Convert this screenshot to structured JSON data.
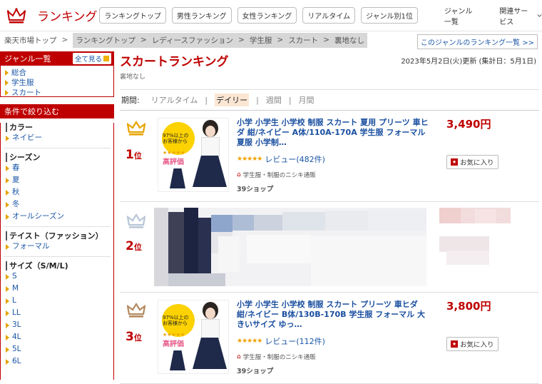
{
  "header": {
    "brand": "ランキング",
    "nav": [
      "ランキングトップ",
      "男性ランキング",
      "女性ランキング",
      "リアルタイム",
      "ジャンル別1位"
    ],
    "genre_list": "ジャンル一覧",
    "related": "関連サービス"
  },
  "breadcrumb": {
    "items": [
      "楽天市場トップ",
      "ランキングトップ",
      "レディースファッション",
      "学生服",
      "スカート",
      "裏地なし"
    ],
    "other_rank_link": "このジャンルのランキング一覧 >>"
  },
  "sidebar": {
    "genre_title": "ジャンル一覧",
    "see_all": "全て見る",
    "genres": [
      "総合",
      "学生服",
      "スカート"
    ],
    "filter_title": "条件で絞り込む",
    "groups": [
      {
        "title": "カラー",
        "items": [
          "ネイビー"
        ]
      },
      {
        "title": "シーズン",
        "items": [
          "春",
          "夏",
          "秋",
          "冬",
          "オールシーズン"
        ]
      },
      {
        "title": "テイスト（ファッション）",
        "items": [
          "フォーマル"
        ]
      },
      {
        "title": "サイズ（S/M/L)",
        "items": [
          "S",
          "M",
          "L",
          "LL",
          "3L",
          "4L",
          "5L",
          "6L"
        ]
      }
    ]
  },
  "main": {
    "title": "スカートランキング",
    "subtitle": "裏地なし",
    "date": "2023年5月2日(火)更新 (集計日：5月1日)",
    "period_label": "期間:",
    "periods": [
      "リアルタイム",
      "デイリー",
      "週間",
      "月間"
    ],
    "active_period": "デイリー",
    "items": [
      {
        "rank": "1",
        "rank_suffix": "位",
        "title": "小学 小学生 小学校 制服 スカート 夏用 プリーツ 車ヒダ 紺/ネイビー A体/110A-170A 学生服 フォーマル 夏服 小学制…",
        "review": "レビュー(482件)",
        "shop": "学生服・制服のニシキ通販",
        "sanq": "39ショップ",
        "price": "3,490円",
        "fav": "お気に入り",
        "thumb_text": "97%以上の\nお客様から",
        "thumb_stars": "★★★★★",
        "thumb_badge": "高評価"
      },
      {
        "rank": "2",
        "rank_suffix": "位"
      },
      {
        "rank": "3",
        "rank_suffix": "位",
        "title": "小学 小学生 小学校 制服 スカート プリーツ 車ヒダ 紺/ネイビー B体/130B-170B 学生服 フォーマル 大きいサイズ ゆっ…",
        "review": "レビュー(112件)",
        "shop": "学生服・制服のニシキ通販",
        "sanq": "39ショップ",
        "price": "3,800円",
        "fav": "お気に入り",
        "thumb_text": "97%以上の\nお客様から",
        "thumb_stars": "★★★★★",
        "thumb_badge": "高評価"
      }
    ]
  },
  "colors": {
    "brand": "#bf0000",
    "link": "#1a4fa0",
    "gold": "#e6a400",
    "silver": "#b9c6d6",
    "bronze": "#b48a60"
  }
}
